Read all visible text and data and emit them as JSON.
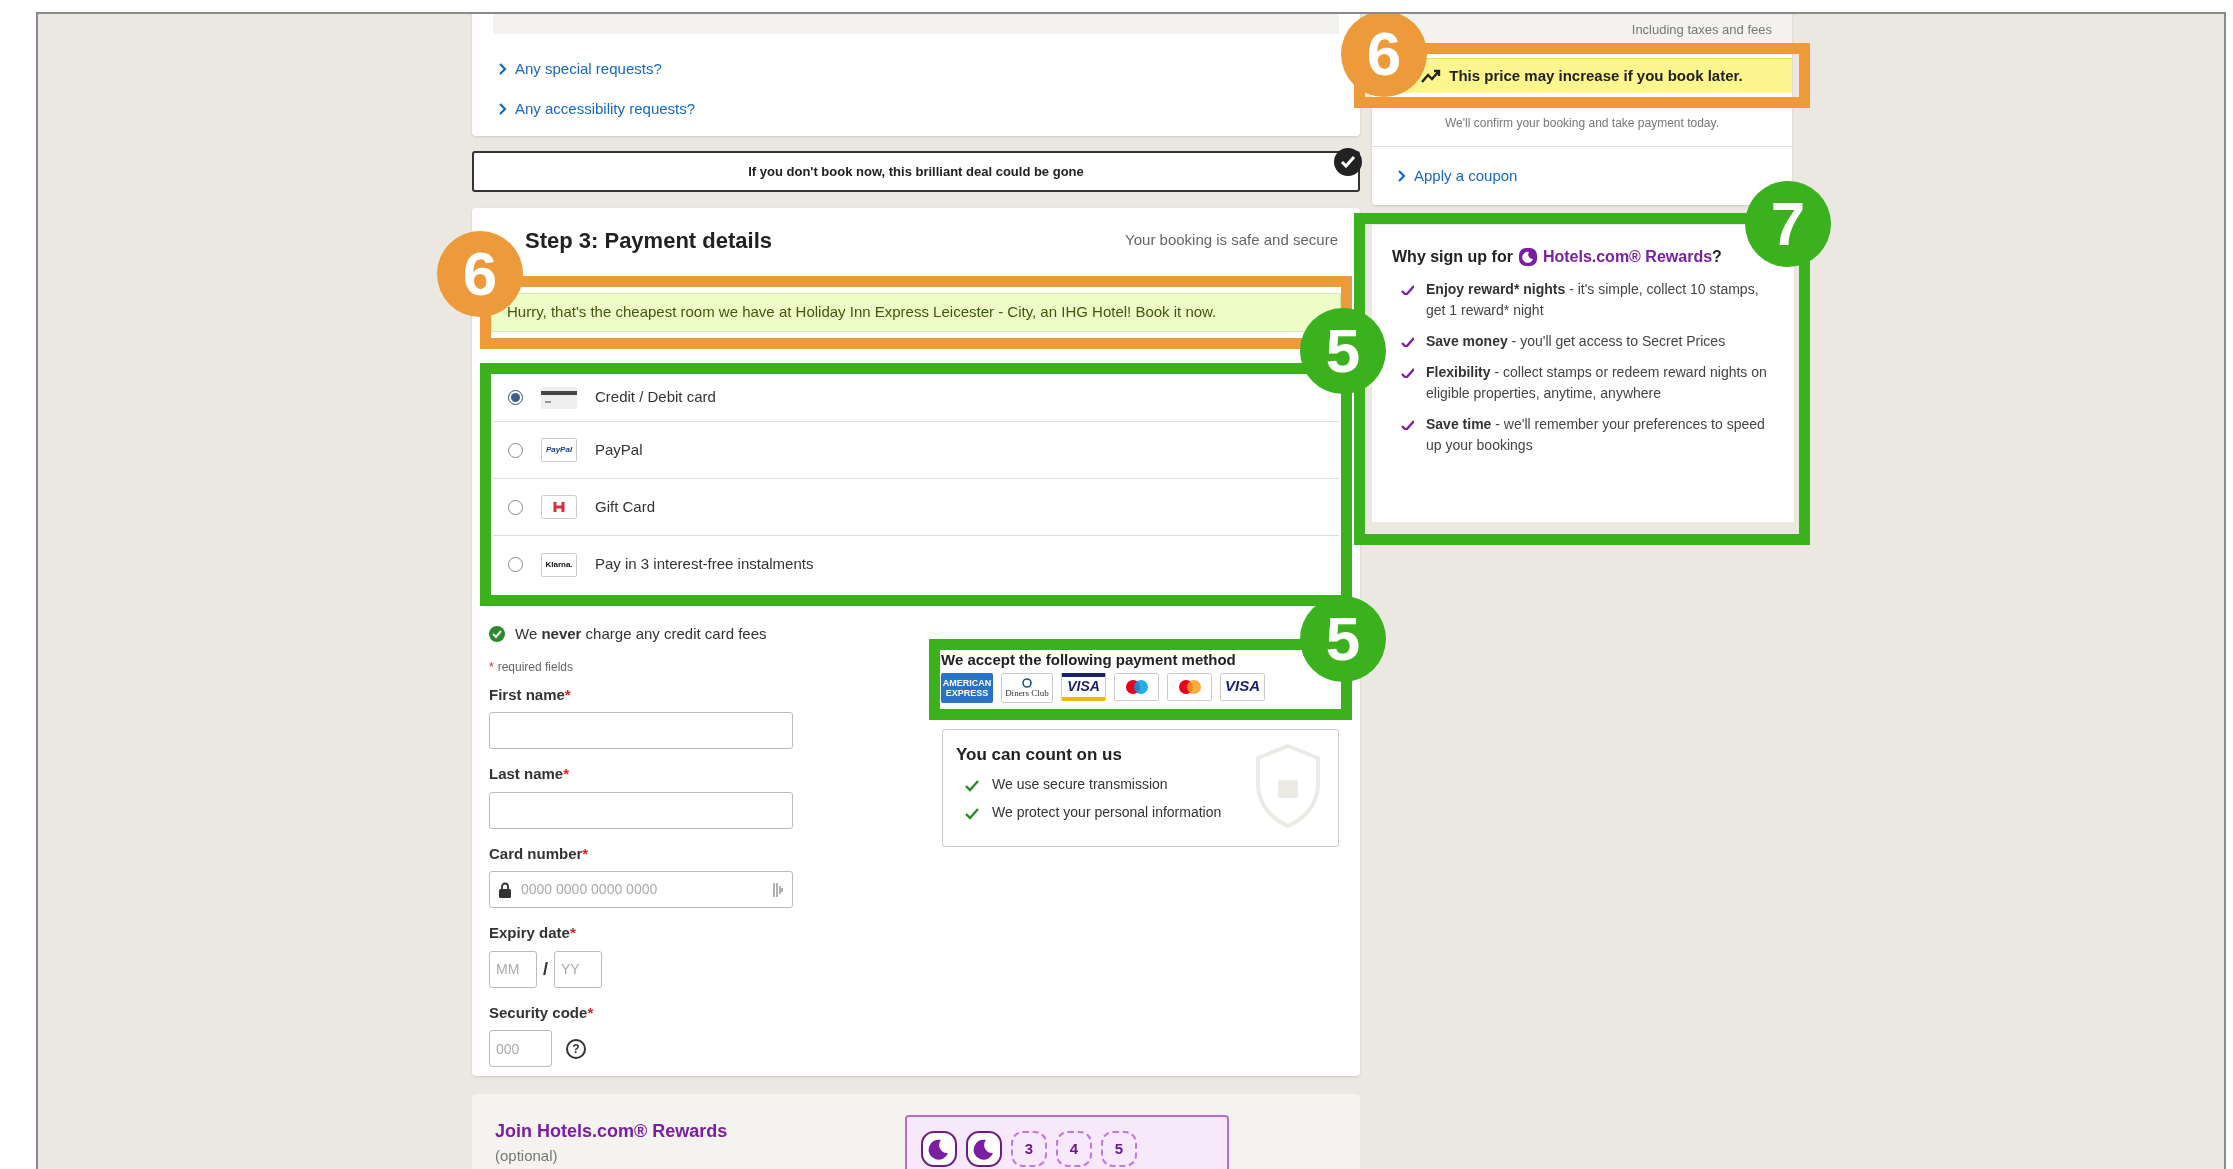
{
  "room_card": {
    "links": [
      "Any special requests?",
      "Any accessibility requests?"
    ]
  },
  "urgency_banner": "If you don't book now, this brilliant deal could be gone",
  "payment": {
    "title": "Step 3: Payment details",
    "security_note": "Your booking is safe and secure",
    "message": "Hurry, that's the cheapest room we have at Holiday Inn Express Leicester - City, an IHG Hotel! Book it now.",
    "message_annotation": {
      "label": "6",
      "color": "#ed9a3a"
    },
    "methods_annotation": {
      "label": "5",
      "color": "#3cb11e"
    },
    "methods": [
      {
        "kind": "card",
        "label": "Credit / Debit card",
        "selected": true
      },
      {
        "kind": "paypal",
        "logo_text": "PayPal",
        "label": "PayPal",
        "selected": false
      },
      {
        "kind": "gift",
        "label": "Gift Card",
        "selected": false
      },
      {
        "kind": "klarna",
        "logo_text": "Klarna.",
        "label": "Pay in 3 interest-free instalments",
        "selected": false
      }
    ],
    "fee_note": "We **never** charge any credit card fees",
    "required_note": {
      "mark": "*",
      "text": "required fields"
    },
    "fields": [
      {
        "kind": "text",
        "label": "First name",
        "mark": "*"
      },
      {
        "kind": "text",
        "label": "Last name",
        "mark": "*"
      },
      {
        "kind": "card",
        "label": "Card number",
        "mark": "*",
        "placeholder": "0000 0000 0000 0000"
      },
      {
        "kind": "expiry",
        "label": "Expiry date",
        "mark": "*",
        "placeholders": [
          "MM",
          "YY"
        ],
        "separator": "/"
      },
      {
        "kind": "cvv",
        "label": "Security code",
        "mark": "*",
        "placeholder": "000",
        "help": "?"
      }
    ],
    "accepted": {
      "title": "We accept the following payment method",
      "annotation": {
        "label": "5",
        "color": "#3cb11e"
      },
      "cards": [
        {
          "kind": "amex",
          "text": "AMERICAN EXPRESS"
        },
        {
          "kind": "diners",
          "text": "Diners Club"
        },
        {
          "kind": "visa_electron",
          "text": "VISA"
        },
        {
          "kind": "maestro"
        },
        {
          "kind": "mastercard"
        },
        {
          "kind": "visa",
          "text": "VISA"
        }
      ]
    },
    "trust": {
      "title": "You can count on us",
      "items": [
        "We use secure transmission",
        "We protect your personal information"
      ]
    }
  },
  "rewards_join": {
    "title": "Join Hotels.com® Rewards",
    "subtitle": "(optional)",
    "stamps": [
      {
        "kind": "filled"
      },
      {
        "kind": "filled"
      },
      {
        "kind": "empty",
        "label": "3"
      },
      {
        "kind": "empty",
        "label": "4"
      },
      {
        "kind": "empty",
        "label": "5"
      }
    ]
  },
  "sidebar": {
    "tax_note": "Including taxes and fees",
    "price_alert": "This price may increase if you book later.",
    "price_alert_annotation": {
      "label": "6",
      "color": "#ed9a3a"
    },
    "confirm_note": "We'll confirm your booking and take payment today.",
    "coupon_link": "Apply a coupon",
    "rewards": {
      "annotation": {
        "label": "7",
        "color": "#3cb11e"
      },
      "title": "Why sign up for",
      "brand": "Hotels.com® Rewards",
      "title_end": "?",
      "benefits": [
        {
          "lead": "Enjoy reward* nights",
          "text": " - it's simple, collect 10 stamps, get 1 reward* night"
        },
        {
          "lead": "Save money",
          "text": " - you'll get access to Secret Prices"
        },
        {
          "lead": "Flexibility",
          "text": " - collect stamps or redeem reward nights on eligible properties, anytime, anywhere"
        },
        {
          "lead": "Save time",
          "text": " - we'll remember your preferences to speed up your bookings"
        }
      ]
    }
  }
}
